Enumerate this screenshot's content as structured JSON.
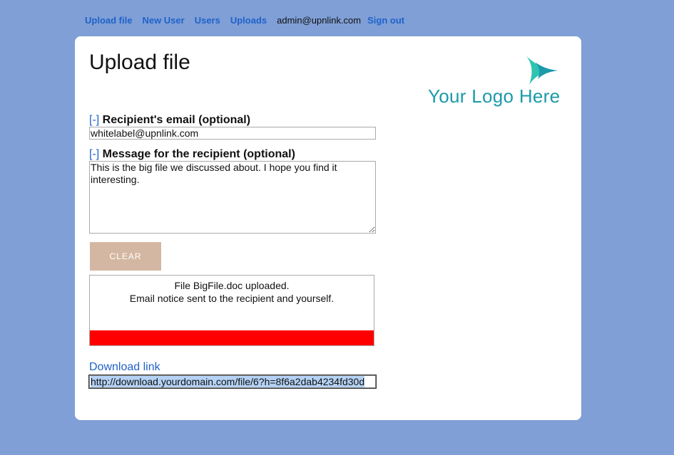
{
  "nav": {
    "upload_file": "Upload file",
    "new_user": "New User",
    "users": "Users",
    "uploads": "Uploads",
    "user_email": "admin@upnlink.com",
    "sign_out": "Sign out"
  },
  "page": {
    "title": "Upload file",
    "logo_text": "Your Logo Here"
  },
  "form": {
    "email_toggle": "[-]",
    "email_label": "Recipient's email (optional)",
    "email_value": "whitelabel@upnlink.com",
    "message_toggle": "[-]",
    "message_label": "Message for the recipient (optional)",
    "message_value": "This is the big file we discussed about. I hope you find it interesting.",
    "clear_button": "CLEAR"
  },
  "status": {
    "line1": "File BigFile.doc uploaded.",
    "line2": "Email notice sent to the recipient and yourself.",
    "progress": 1.0,
    "progress_color": "#ff0000"
  },
  "download": {
    "label": "Download link",
    "url": "http://download.yourdomain.com/file/6?h=8f6a2dab4234fd30d"
  },
  "colors": {
    "background": "#7f9fd6",
    "link": "#1f62c9",
    "logo": "#1b9aaa",
    "button": "#d4b7a2"
  },
  "icons": {
    "logo_mark": "arrow-logo-icon"
  }
}
